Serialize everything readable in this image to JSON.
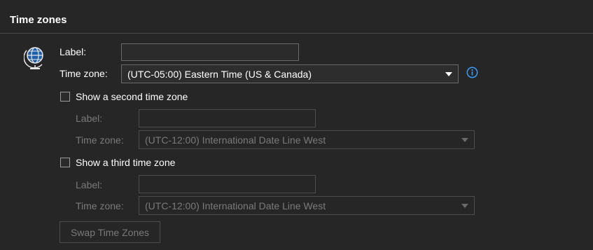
{
  "section": {
    "title": "Time zones"
  },
  "primary": {
    "label_caption": "Label:",
    "label_value": "",
    "timezone_caption": "Time zone:",
    "timezone_value": "(UTC-05:00) Eastern Time (US & Canada)"
  },
  "second": {
    "checkbox_label": "Show a second time zone",
    "checked": false,
    "label_caption": "Label:",
    "label_value": "",
    "timezone_caption": "Time zone:",
    "timezone_value": "(UTC-12:00) International Date Line West"
  },
  "third": {
    "checkbox_label": "Show a third time zone",
    "checked": false,
    "label_caption": "Label:",
    "label_value": "",
    "timezone_caption": "Time zone:",
    "timezone_value": "(UTC-12:00) International Date Line West"
  },
  "swap_button": {
    "label": "Swap Time Zones",
    "enabled": false
  },
  "colors": {
    "background": "#262626",
    "info_accent": "#3b9cff",
    "disabled_text": "#7a7a7a"
  },
  "icons": {
    "globe": "globe-icon",
    "info": "info-icon",
    "dropdown": "chevron-down-icon"
  }
}
